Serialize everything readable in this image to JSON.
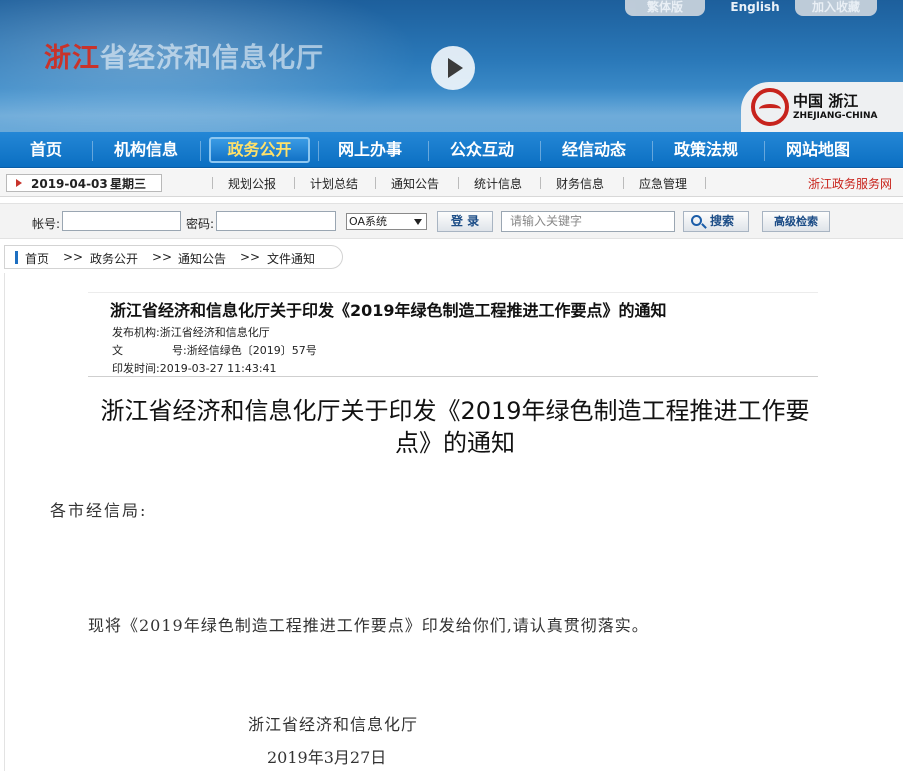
{
  "header": {
    "site_title_red": "浙江",
    "site_title_rest": "省经济和信息化厅",
    "top_links": [
      "繁体版",
      "English",
      "加入收藏"
    ],
    "logo_cn": "中国 浙江",
    "logo_en": "ZHEJIANG-CHINA"
  },
  "main_nav": {
    "items": [
      "首页",
      "机构信息",
      "政务公开",
      "网上办事",
      "公众互动",
      "经信动态",
      "政策法规",
      "网站地图"
    ],
    "active": "政务公开"
  },
  "sub_nav": {
    "date": "2019-04-03",
    "weekday": "星期三",
    "items": [
      "规划公报",
      "计划总结",
      "通知公告",
      "统计信息",
      "财务信息",
      "应急管理"
    ],
    "service_link": "浙江政务服务网"
  },
  "login_bar": {
    "account_label": "帐号:",
    "password_label": "密码:",
    "system_select": "OA系统",
    "login_button": "登 录",
    "search_placeholder": "请输入关键字",
    "search_button": "搜索",
    "advanced_search_button": "高级检索"
  },
  "breadcrumb": [
    "首页",
    "政务公开",
    "通知公告",
    "文件通知"
  ],
  "breadcrumb_sep": ">>",
  "article": {
    "meta_title": "浙江省经济和信息化厅关于印发《2019年绿色制造工程推进工作要点》的通知",
    "publisher_label": "发布机构:",
    "publisher": "浙江省经济和信息化厅",
    "doc_no_label_1": "文",
    "doc_no_label_2": "号:",
    "doc_no": "浙经信绿色〔2019〕57号",
    "print_time_label": "印发时间:",
    "print_time": "2019-03-27 11:43:41",
    "title_line1": "浙江省经济和信息化厅关于印发《2019年绿色制造工程推进工作要",
    "title_line2": "点》的通知",
    "salutation": "各市经信局:",
    "body": "现将《2019年绿色制造工程推进工作要点》印发给你们,请认真贯彻落实。",
    "signature_org": "浙江省经济和信息化厅",
    "signature_date": "2019年3月27日"
  }
}
